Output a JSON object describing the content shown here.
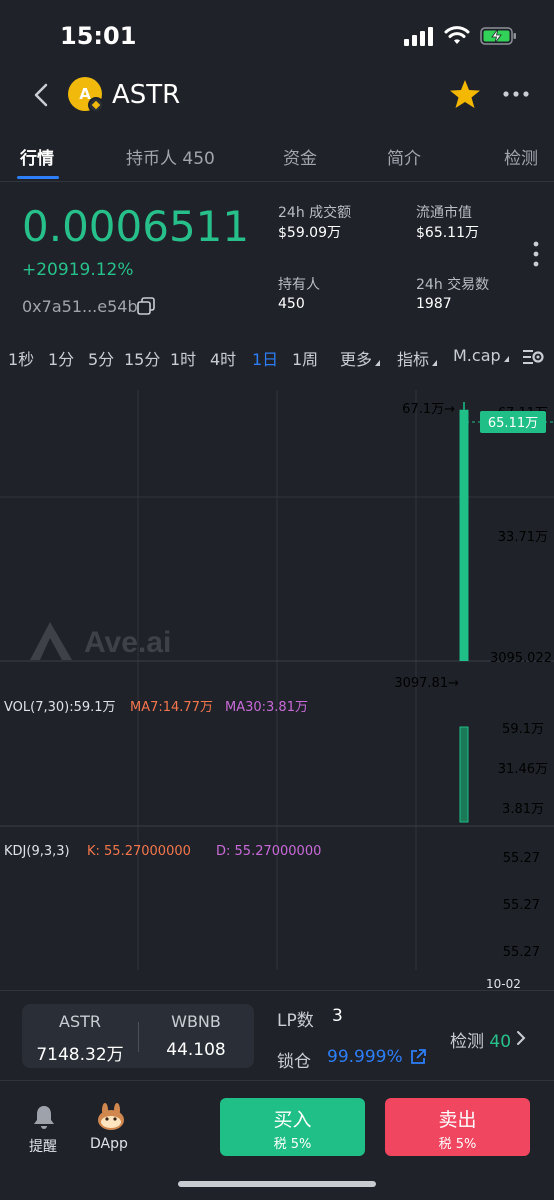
{
  "status_bar": {
    "time": "15:01"
  },
  "header": {
    "coin_symbol": "ASTR",
    "logo_letter": "A"
  },
  "tabs": [
    {
      "label": "行情",
      "active": true
    },
    {
      "label": "持币人 450",
      "active": false
    },
    {
      "label": "资金",
      "active": false
    },
    {
      "label": "简介",
      "active": false
    },
    {
      "label": "检测",
      "active": false
    }
  ],
  "overview": {
    "price": "0.0006511",
    "change": "+20919.12%",
    "address": "0x7a51...e54b",
    "stats": [
      {
        "label": "24h 成交额",
        "value": "$59.09万"
      },
      {
        "label": "流通市值",
        "value": "$65.11万"
      },
      {
        "label": "持有人",
        "value": "450"
      },
      {
        "label": "24h 交易数",
        "value": "1987"
      }
    ]
  },
  "intervals": [
    "1秒",
    "1分",
    "5分",
    "15分",
    "1时",
    "4时",
    "1日",
    "1周"
  ],
  "active_interval": "1日",
  "dropdowns": [
    "更多",
    "指标",
    "M.cap"
  ],
  "chart": {
    "watermark": "Ave.ai",
    "price_axis": [
      "67.11万",
      "33.71万",
      "3095.022"
    ],
    "current_tag": "65.11万",
    "high_marker": "67.1万→",
    "low_marker": "3097.81→",
    "vol_label": "VOL(7,30):59.1万",
    "ma7_label": "MA7:14.77万",
    "ma30_label": "MA30:3.81万",
    "vol_axis": [
      "59.1万",
      "31.46万",
      "3.81万"
    ],
    "kdj_label": "KDJ(9,3,3)",
    "k_label": "K: 55.27000000",
    "d_label": "D: 55.27000000",
    "kdj_axis": [
      "55.27",
      "55.27",
      "55.27"
    ],
    "date_label": "10-02",
    "colors": {
      "up": "#1fbf87",
      "ma7": "#f4764c",
      "ma30": "#c86ad8",
      "accent": "#2d7ef7"
    }
  },
  "chart_data": {
    "type": "candlestick",
    "x": [
      "10-02"
    ],
    "open": [
      3097.81
    ],
    "high": [
      671100
    ],
    "low": [
      3097.81
    ],
    "close": [
      651100
    ],
    "volume": [
      591000
    ]
  },
  "pool": {
    "token_a": "ASTR",
    "amount_a": "7148.32万",
    "token_b": "WBNB",
    "amount_b": "44.108",
    "lp_label": "LP数",
    "lp_value": "3",
    "lock_label": "锁仓",
    "lock_value": "99.999%",
    "check_label": "检测",
    "check_value": "40"
  },
  "footer": {
    "remind": "提醒",
    "dapp": "DApp",
    "buy": "买入",
    "buy_tax": "税 5%",
    "sell": "卖出",
    "sell_tax": "税 5%"
  }
}
